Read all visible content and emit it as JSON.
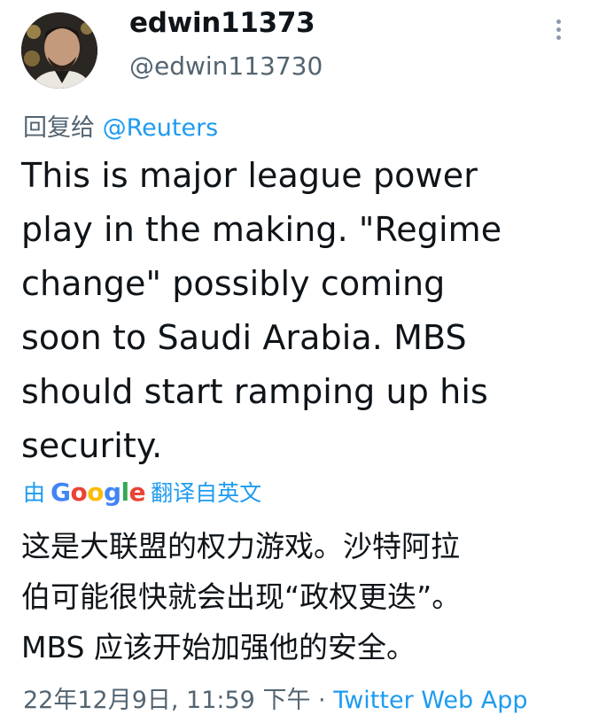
{
  "header": {
    "display_name": "edwin11373",
    "handle": "@edwin113730",
    "more_icon": "more-vertical-icon"
  },
  "reply": {
    "prefix": "回复给",
    "mention": "@Reuters"
  },
  "tweet": {
    "text_lines": [
      "This is major league power",
      "play in the making. \"Regime",
      "change\" possibly coming",
      "soon to Saudi Arabia. MBS",
      "should start ramping up his",
      "security."
    ]
  },
  "translation": {
    "by": "由",
    "logo_text": "Google",
    "suffix": "翻译自英文",
    "lines": [
      "这是大联盟的权力游戏。沙特阿拉",
      "伯可能很快就会出现“政权更迭”。",
      "MBS 应该开始加强他的安全。"
    ]
  },
  "meta": {
    "timestamp": "22年12月9日, 11:59 下午 · ",
    "source": "Twitter Web App"
  },
  "colors": {
    "link": "#1d9bf0",
    "muted": "#536471",
    "text": "#0f1419"
  }
}
